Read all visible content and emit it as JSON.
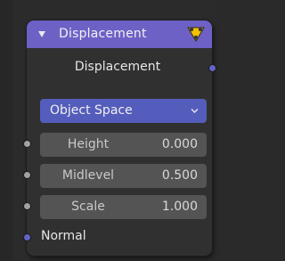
{
  "node": {
    "title": "Displacement",
    "header_color": "#6d61c6",
    "output": {
      "label": "Displacement",
      "socket_type": "vector"
    },
    "space_dropdown": {
      "selected": "Object Space",
      "color": "#545dbb"
    },
    "inputs": [
      {
        "name": "Height",
        "value": "0.000",
        "socket_type": "float"
      },
      {
        "name": "Midlevel",
        "value": "0.500",
        "socket_type": "float"
      },
      {
        "name": "Scale",
        "value": "1.000",
        "socket_type": "float"
      },
      {
        "name": "Normal",
        "socket_type": "vector"
      }
    ],
    "icons": {
      "collapse": "collapse-triangle-icon",
      "preview": "node-preview-icon",
      "dropdown": "chevron-down-icon"
    }
  }
}
